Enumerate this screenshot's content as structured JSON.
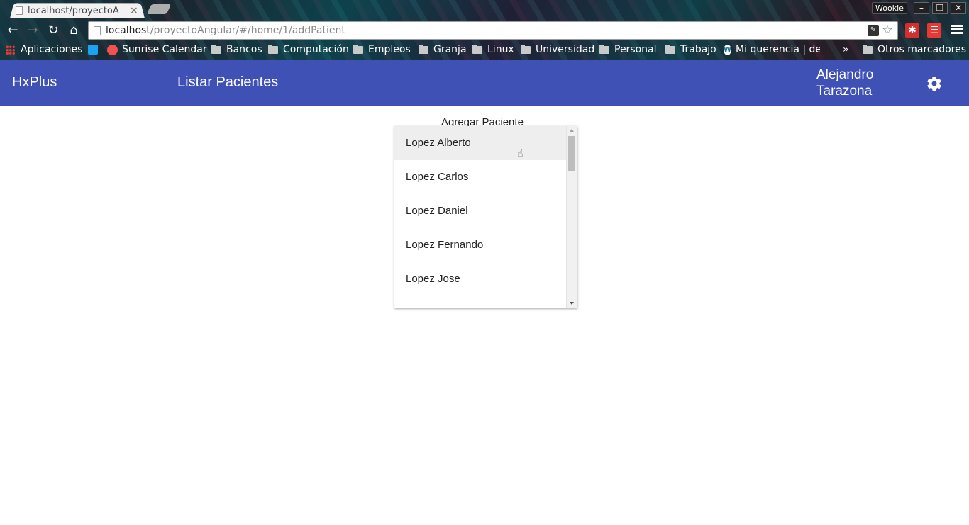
{
  "browser": {
    "tab_title": "localhost/proyectoA",
    "tab_close": "×",
    "profile_name": "Wookie",
    "window_buttons": {
      "minimize": "–",
      "restore": "❐",
      "close": "✕"
    },
    "url_host": "localhost",
    "url_path": "/proyectoAngular/#/home/1/addPatient",
    "nav": {
      "back": "←",
      "forward": "→",
      "reload": "↻",
      "home": "⌂"
    },
    "extensions": [
      {
        "label": "✱",
        "color": "#d32f2f"
      },
      {
        "label": "☰",
        "color": "#d32f2f"
      }
    ],
    "bookmarks": [
      {
        "label": "Aplicaciones",
        "icon": "apps-grid-icon"
      },
      {
        "label": "",
        "icon": "twitter-icon"
      },
      {
        "label": "Sunrise Calendar",
        "icon": "sunrise-icon"
      },
      {
        "label": "Bancos",
        "icon": "folder-icon"
      },
      {
        "label": "Computación",
        "icon": "folder-icon"
      },
      {
        "label": "Empleos",
        "icon": "folder-icon"
      },
      {
        "label": "Granja",
        "icon": "folder-icon"
      },
      {
        "label": "Linux",
        "icon": "folder-icon"
      },
      {
        "label": "Universidad",
        "icon": "folder-icon"
      },
      {
        "label": "Personal",
        "icon": "folder-icon"
      },
      {
        "label": "Trabajo",
        "icon": "folder-icon"
      },
      {
        "label": "Mi querencia | de",
        "icon": "wordpress-icon"
      }
    ],
    "bookmarks_overflow": "»",
    "other_bookmarks": "Otros marcadores"
  },
  "app": {
    "brand": "HxPlus",
    "nav_link": "Listar Pacientes",
    "user_first": "Alejandro",
    "user_last": "Tarazona",
    "accent_color": "#3f51b5"
  },
  "main": {
    "heading": "Agregar Paciente",
    "patient_options": [
      "Lopez Alberto",
      "Lopez Carlos",
      "Lopez Daniel",
      "Lopez Fernando",
      "Lopez Jose"
    ],
    "hovered_index": 0
  }
}
